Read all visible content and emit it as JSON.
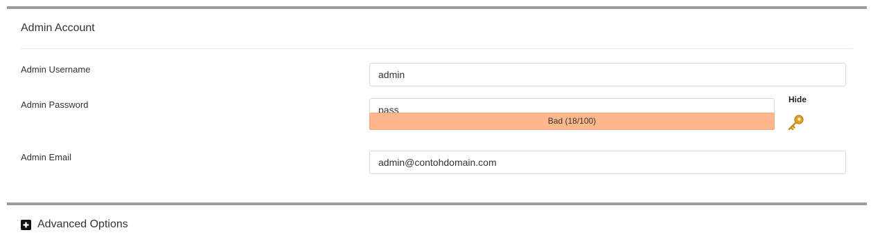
{
  "admin_account": {
    "title": "Admin Account",
    "username": {
      "label": "Admin Username",
      "value": "admin"
    },
    "password": {
      "label": "Admin Password",
      "value": "pass",
      "toggle_label": "Hide",
      "strength": {
        "text": "Bad (18/100)",
        "score": 18,
        "max": 100,
        "color": "#ffb78b"
      },
      "generator_icon": "key-icon"
    },
    "email": {
      "label": "Admin Email",
      "value": "admin@contohdomain.com"
    }
  },
  "advanced_options": {
    "label": "Advanced Options",
    "icon": "plus-square-icon"
  },
  "colors": {
    "panel_border": "#9a9a9a",
    "input_border": "#d9d9d9",
    "strength_border": "#f0a77c",
    "key_icon": "#e2a322"
  }
}
